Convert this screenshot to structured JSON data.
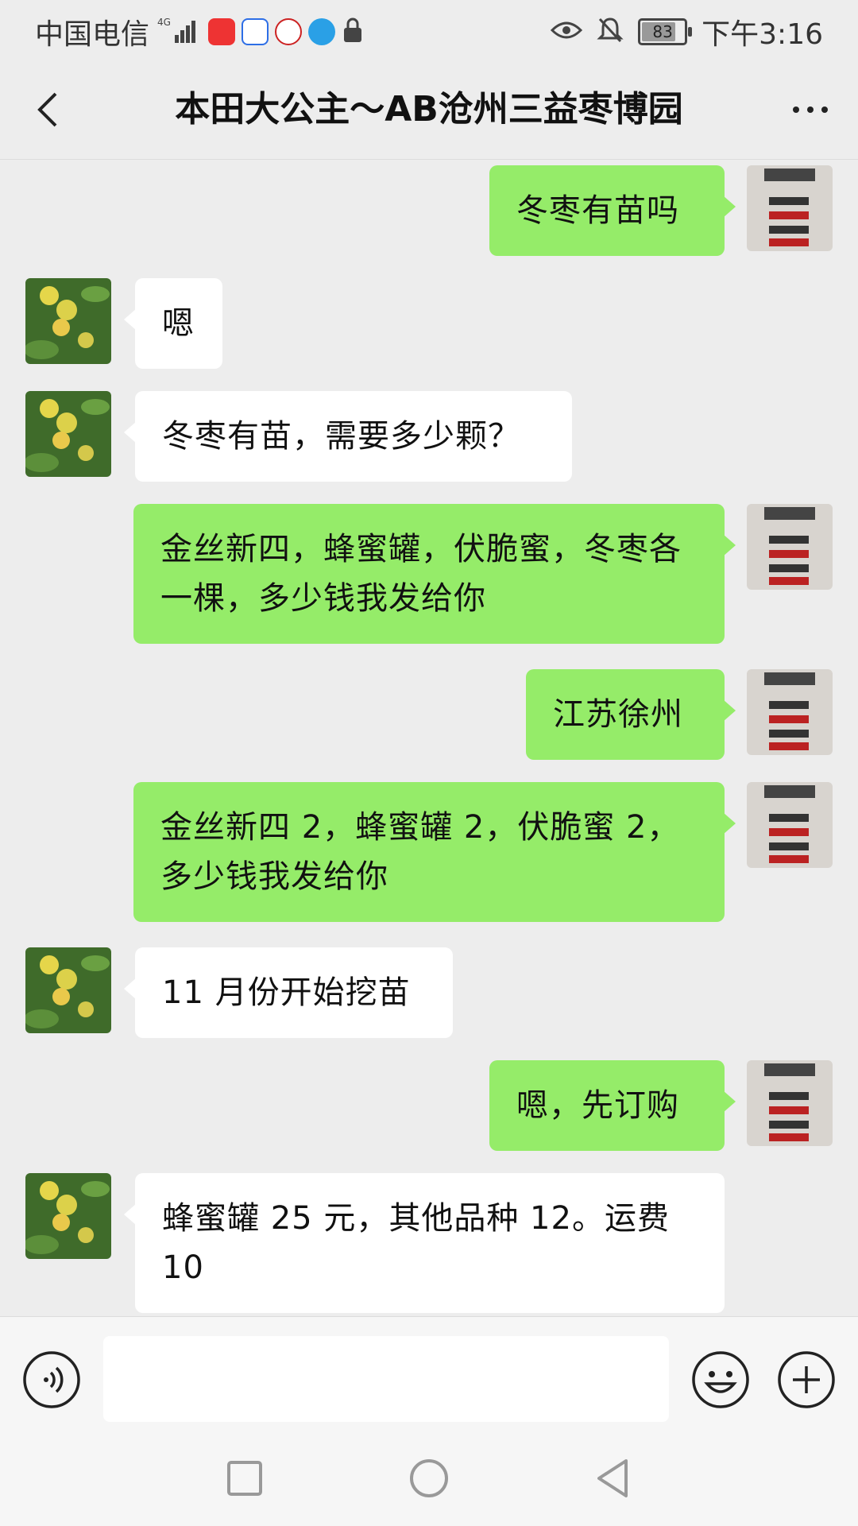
{
  "status_bar": {
    "carrier": "中国电信",
    "network": "4G",
    "battery": "83",
    "time": "下午3:16",
    "icons": [
      "signal-icon",
      "huawei-app-icon",
      "baidu-icon",
      "app-icon",
      "browser-icon",
      "lock-icon",
      "eye-icon",
      "bell-off-icon",
      "battery-icon"
    ]
  },
  "header": {
    "title": "本田大公主～AB沧州三益枣博园",
    "back_icon": "chevron-left-icon",
    "more_icon": "more-icon"
  },
  "messages": [
    {
      "side": "out",
      "text": "冬枣有苗吗"
    },
    {
      "side": "in",
      "text": "嗯"
    },
    {
      "side": "in",
      "text": "冬枣有苗，需要多少颗？"
    },
    {
      "side": "out",
      "text": "金丝新四，蜂蜜罐，伏脆蜜，冬枣各一棵，多少钱我发给你"
    },
    {
      "side": "out",
      "text": "江苏徐州"
    },
    {
      "side": "out",
      "text": "金丝新四 2，蜂蜜罐 2，伏脆蜜 2，多少钱我发给你"
    },
    {
      "side": "in",
      "text": "11 月份开始挖苗"
    },
    {
      "side": "out",
      "text": "嗯，先订购"
    },
    {
      "side": "in",
      "text": "蜂蜜罐 25 元，其他品种 12。运费 10"
    }
  ],
  "input": {
    "value": "",
    "placeholder": ""
  },
  "colors": {
    "outgoing_bubble": "#95ec69",
    "incoming_bubble": "#ffffff",
    "background": "#ededed"
  }
}
